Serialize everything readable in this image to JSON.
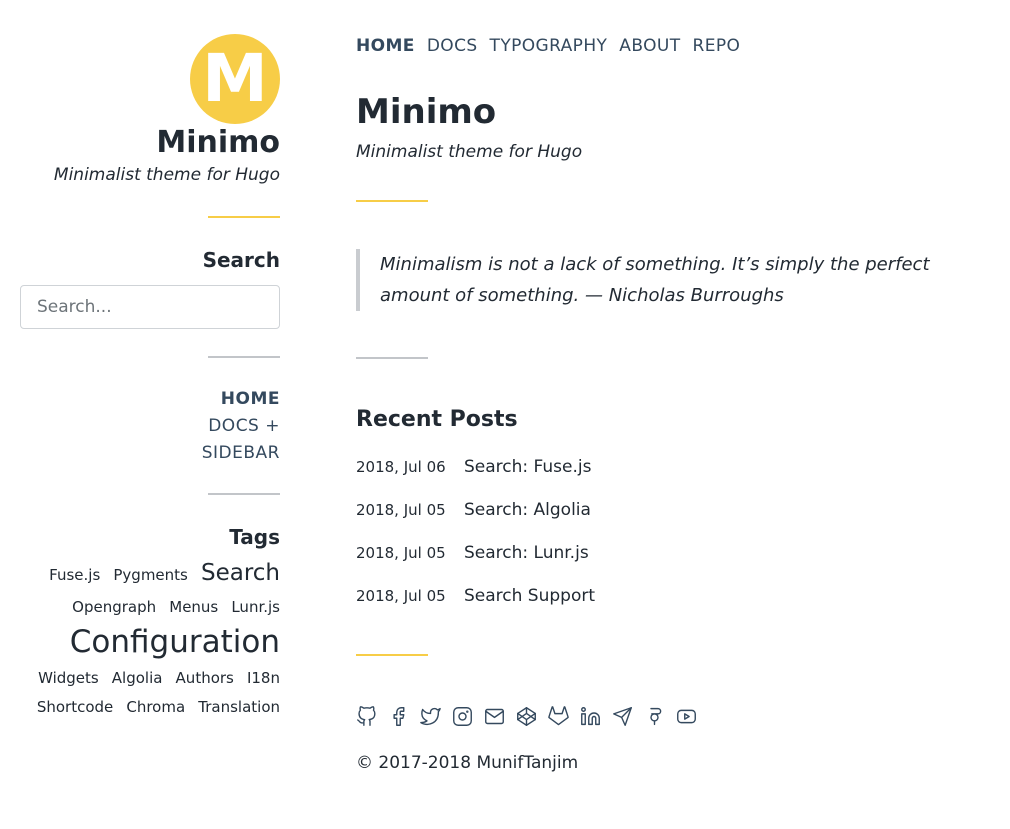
{
  "site": {
    "logo_letter": "M",
    "name": "Minimo",
    "tagline": "Minimalist theme for Hugo"
  },
  "sidebar": {
    "search_heading": "Search",
    "search_placeholder": "Search...",
    "menu": [
      {
        "label": "HOME"
      },
      {
        "label": "DOCS +"
      },
      {
        "label": "SIDEBAR"
      }
    ],
    "tags_heading": "Tags",
    "tags": [
      {
        "label": "Fuse.js"
      },
      {
        "label": "Pygments"
      },
      {
        "label": "Search"
      },
      {
        "label": "Opengraph"
      },
      {
        "label": "Menus"
      },
      {
        "label": "Lunr.js"
      },
      {
        "label": "Configuration"
      },
      {
        "label": "Widgets"
      },
      {
        "label": "Algolia"
      },
      {
        "label": "Authors"
      },
      {
        "label": "I18n"
      },
      {
        "label": "Shortcode"
      },
      {
        "label": "Chroma"
      },
      {
        "label": "Translation"
      }
    ]
  },
  "nav": {
    "items": [
      {
        "label": "HOME"
      },
      {
        "label": "DOCS"
      },
      {
        "label": "TYPOGRAPHY"
      },
      {
        "label": "ABOUT"
      },
      {
        "label": "REPO"
      }
    ]
  },
  "main": {
    "title": "Minimo",
    "subtitle": "Minimalist theme for Hugo",
    "quote": "Minimalism is not a lack of something. It’s simply the perfect amount of something. — Nicholas Burroughs",
    "recent_heading": "Recent Posts",
    "posts": [
      {
        "date": "2018, Jul 06",
        "title": "Search: Fuse.js"
      },
      {
        "date": "2018, Jul 05",
        "title": "Search: Algolia"
      },
      {
        "date": "2018, Jul 05",
        "title": "Search: Lunr.js"
      },
      {
        "date": "2018, Jul 05",
        "title": "Search Support"
      }
    ]
  },
  "footer": {
    "social_icons": [
      "github-icon",
      "facebook-icon",
      "twitter-icon",
      "instagram-icon",
      "email-icon",
      "codepen-icon",
      "gitlab-icon",
      "linkedin-icon",
      "telegram-icon",
      "google-plus-icon",
      "youtube-icon"
    ],
    "copyright": "© 2017-2018 MunifTanjim"
  },
  "colors": {
    "accent": "#f7cd47",
    "text": "#222a33",
    "nav": "#34495e",
    "separator_gray": "#c2c5c9"
  }
}
